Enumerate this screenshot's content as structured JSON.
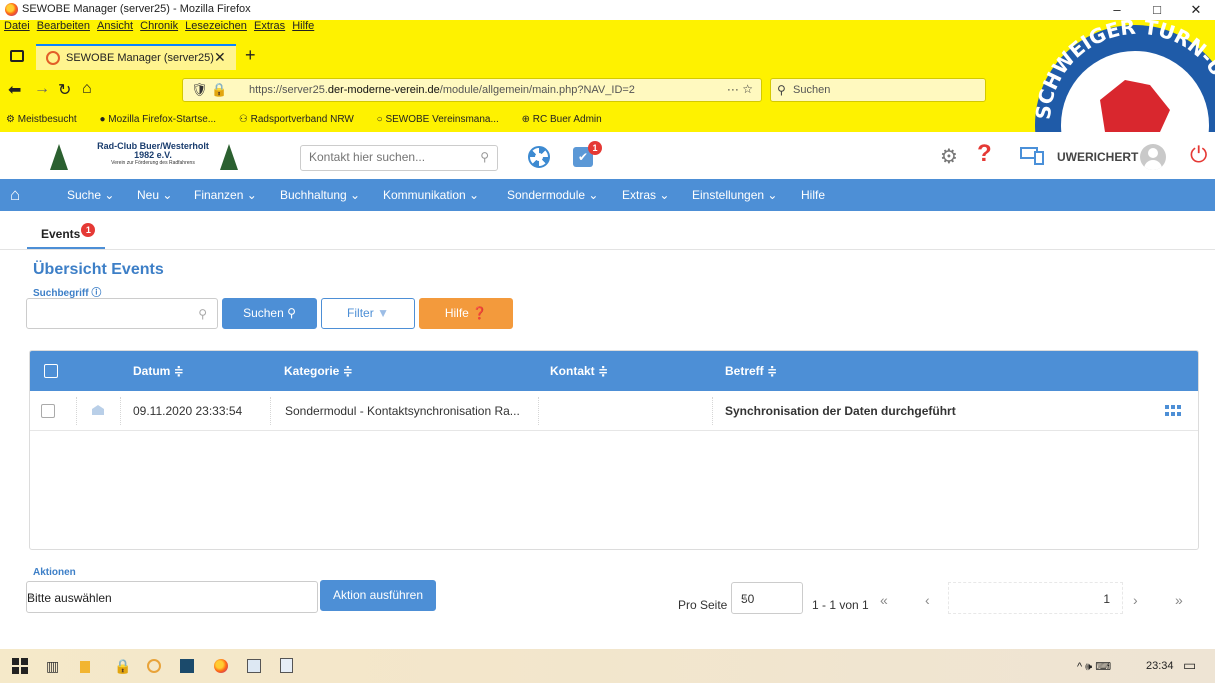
{
  "window": {
    "title": "SEWOBE Manager (server25) - Mozilla Firefox",
    "controls": [
      "–",
      "□",
      "✕"
    ]
  },
  "browser": {
    "menu": [
      "Datei",
      "Bearbeiten",
      "Ansicht",
      "Chronik",
      "Lesezeichen",
      "Extras",
      "Hilfe"
    ],
    "tab_title": "SEWOBE Manager (server25)",
    "url_prefix": "https://server25.",
    "url_domain": "der-moderne-verein.de",
    "url_path": "/module/allgemein/main.php?NAV_ID=2",
    "search_placeholder": "Suchen",
    "bookmarks": [
      "Meistbesucht",
      "Mozilla Firefox-Startse...",
      "Radsportverband NRW",
      "SEWOBE Vereinsmana...",
      "RC Buer Admin"
    ],
    "theme_text": "SCHWEIGER TURN-U.SPORTVEREIN",
    "accent": "#fef200"
  },
  "header": {
    "club_line1": "Rad-Club Buer/Westerholt",
    "club_line2": "1982 e.V.",
    "club_line3": "Verein zur Förderung des Radfahrens",
    "contact_search_placeholder": "Kontakt hier suchen...",
    "calendar_badge": "1",
    "username": "UWERICHERT",
    "brand_color": "#4d8fd6"
  },
  "menu": {
    "items": [
      "Suche ⌄",
      "Neu ⌄",
      "Finanzen ⌄",
      "Buchhaltung ⌄",
      "Kommunikation ⌄",
      "Sondermodule ⌄",
      "Extras ⌄",
      "Einstellungen ⌄",
      "Hilfe"
    ]
  },
  "content": {
    "tab_label": "Events",
    "tab_badge": "1",
    "title": "Übersicht Events",
    "search_label": "Suchbegriff ⓘ",
    "search_value": "",
    "btn_search": "Suchen",
    "btn_filter": "Filter",
    "btn_help": "Hilfe"
  },
  "table": {
    "columns": [
      "Datum ≑",
      "Kategorie ≑",
      "Kontakt ≑",
      "Betreff ≑"
    ],
    "rows": [
      {
        "datum": "09.11.2020 23:33:54",
        "kategorie": "Sondermodul - Kontaktsynchronisation Ra...",
        "kontakt": "",
        "betreff": "Synchronisation der Daten durchgeführt"
      }
    ]
  },
  "footer": {
    "actions_label": "Aktionen",
    "action_select": "Bitte auswählen",
    "action_button": "Aktion ausführen",
    "per_page_label": "Pro Seite",
    "per_page": "50",
    "range": "1 - 1 von 1",
    "page": "1"
  },
  "taskbar": {
    "time": "23:34",
    "tray": "^ 🕪 ⌨"
  }
}
